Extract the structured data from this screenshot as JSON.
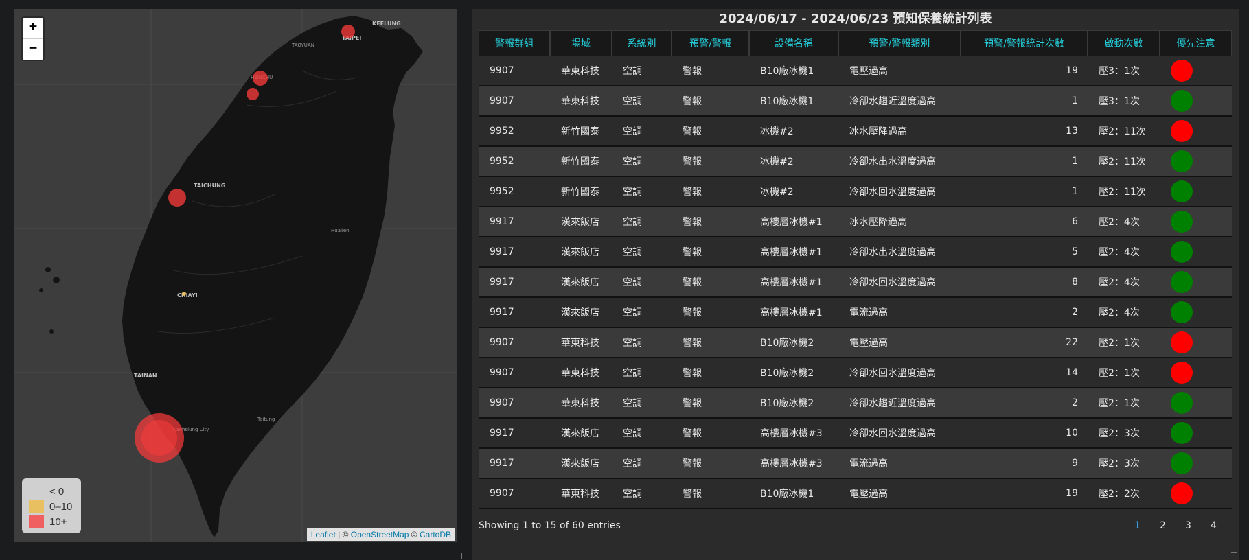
{
  "map": {
    "zoom_in": "+",
    "zoom_out": "−",
    "legend": [
      {
        "label": "< 0",
        "color": ""
      },
      {
        "label": "0–10",
        "color": "#e8c060"
      },
      {
        "label": "10+",
        "color": "#f06060"
      }
    ],
    "attribution": {
      "leaflet": "Leaflet",
      "sep1": " | © ",
      "osm": "OpenStreetMap",
      "sep2": " © ",
      "carto": "CartoDB"
    },
    "cities": {
      "keelung": "KEELUNG",
      "taipei": "TAIPEI",
      "taoyuan": "TAOYUAN",
      "hsinchu": "HSINCHU",
      "taichung": "TAICHUNG",
      "chiayi": "CHIAYI",
      "tainan": "TAINAN",
      "kaohsiung": "Kaohsiung City",
      "hualien": "Hualien",
      "taitung": "Taitung"
    },
    "marker_color": "#ff3b3b"
  },
  "table": {
    "title": "2024/06/17 - 2024/06/23 預知保養統計列表",
    "columns": [
      "警報群組",
      "場域",
      "系統別",
      "預警/警報",
      "設備名稱",
      "預警/警報類別",
      "預警/警報統計次數",
      "啟動次數",
      "優先注意"
    ],
    "rows": [
      [
        "9907",
        "華東科技",
        "空調",
        "警報",
        "B10廠冰機1",
        "電壓過高",
        "19",
        "壓3：1次",
        "red"
      ],
      [
        "9907",
        "華東科技",
        "空調",
        "警報",
        "B10廠冰機1",
        "冷卻水趨近溫度過高",
        "1",
        "壓3：1次",
        "green"
      ],
      [
        "9952",
        "新竹國泰",
        "空調",
        "警報",
        "冰機#2",
        "冰水壓降過高",
        "13",
        "壓2：11次",
        "red"
      ],
      [
        "9952",
        "新竹國泰",
        "空調",
        "警報",
        "冰機#2",
        "冷卻水出水溫度過高",
        "1",
        "壓2：11次",
        "green"
      ],
      [
        "9952",
        "新竹國泰",
        "空調",
        "警報",
        "冰機#2",
        "冷卻水回水溫度過高",
        "1",
        "壓2：11次",
        "green"
      ],
      [
        "9917",
        "漢來飯店",
        "空調",
        "警報",
        "高樓層冰機#1",
        "冰水壓降過高",
        "6",
        "壓2：4次",
        "green"
      ],
      [
        "9917",
        "漢來飯店",
        "空調",
        "警報",
        "高樓層冰機#1",
        "冷卻水出水溫度過高",
        "5",
        "壓2：4次",
        "green"
      ],
      [
        "9917",
        "漢來飯店",
        "空調",
        "警報",
        "高樓層冰機#1",
        "冷卻水回水溫度過高",
        "8",
        "壓2：4次",
        "green"
      ],
      [
        "9917",
        "漢來飯店",
        "空調",
        "警報",
        "高樓層冰機#1",
        "電流過高",
        "2",
        "壓2：4次",
        "green"
      ],
      [
        "9907",
        "華東科技",
        "空調",
        "警報",
        "B10廠冰機2",
        "電壓過高",
        "22",
        "壓2：1次",
        "red"
      ],
      [
        "9907",
        "華東科技",
        "空調",
        "警報",
        "B10廠冰機2",
        "冷卻水回水溫度過高",
        "14",
        "壓2：1次",
        "red"
      ],
      [
        "9907",
        "華東科技",
        "空調",
        "警報",
        "B10廠冰機2",
        "冷卻水趨近溫度過高",
        "2",
        "壓2：1次",
        "green"
      ],
      [
        "9917",
        "漢來飯店",
        "空調",
        "警報",
        "高樓層冰機#3",
        "冷卻水回水溫度過高",
        "10",
        "壓2：3次",
        "green"
      ],
      [
        "9917",
        "漢來飯店",
        "空調",
        "警報",
        "高樓層冰機#3",
        "電流過高",
        "9",
        "壓2：3次",
        "green"
      ],
      [
        "9907",
        "華東科技",
        "空調",
        "警報",
        "B10廠冰機1",
        "電壓過高",
        "19",
        "壓2：2次",
        "red"
      ]
    ],
    "info": "Showing 1 to 15 of 60 entries",
    "pages": [
      "1",
      "2",
      "3",
      "4"
    ],
    "active_page": "1"
  }
}
